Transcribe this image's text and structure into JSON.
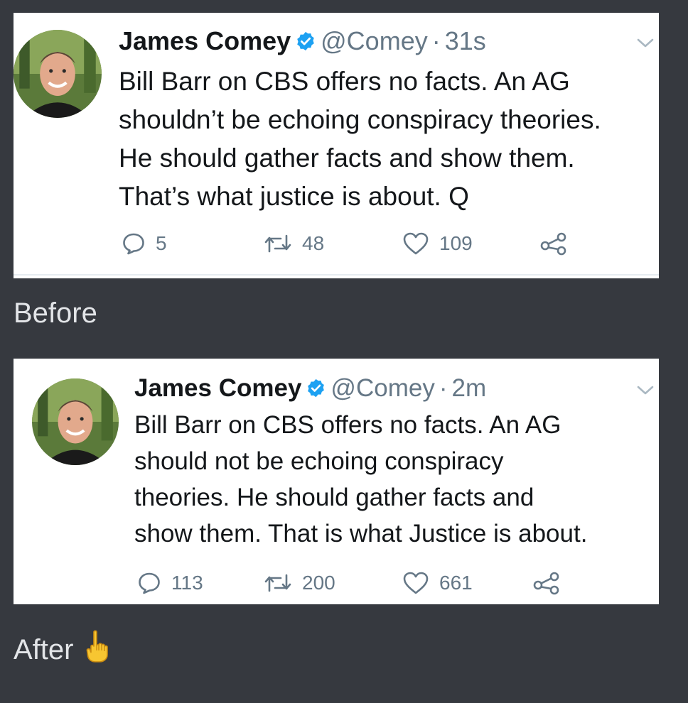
{
  "tweets": [
    {
      "name": "James Comey",
      "handle": "@Comey",
      "separator": "·",
      "time": "31s",
      "lines": [
        "Bill Barr on CBS offers no facts. An AG",
        "shouldn’t be echoing conspiracy theories.",
        "He should gather facts and show them.",
        "That’s what justice is about. Q"
      ],
      "replies": "5",
      "retweets": "48",
      "likes": "109"
    },
    {
      "name": "James Comey",
      "handle": "@Comey",
      "separator": "·",
      "time": "2m",
      "lines": [
        "Bill Barr on CBS offers no facts. An AG",
        "should not be echoing conspiracy",
        "theories. He should gather facts and",
        "show them. That is what Justice is about."
      ],
      "replies": "113",
      "retweets": "200",
      "likes": "661"
    }
  ],
  "captions": {
    "before": "Before",
    "after": "After"
  },
  "icons": {
    "verified": "verified-badge-icon",
    "caret": "chevron-down-icon",
    "reply": "reply-icon",
    "retweet": "retweet-icon",
    "like": "heart-icon",
    "share": "share-icon",
    "emoji": "pointing-up-hand-icon"
  },
  "colors": {
    "background": "#36393f",
    "card": "#ffffff",
    "text": "#14171a",
    "muted": "#657786",
    "verified": "#1da1f2",
    "caption": "#e3e5e8"
  }
}
